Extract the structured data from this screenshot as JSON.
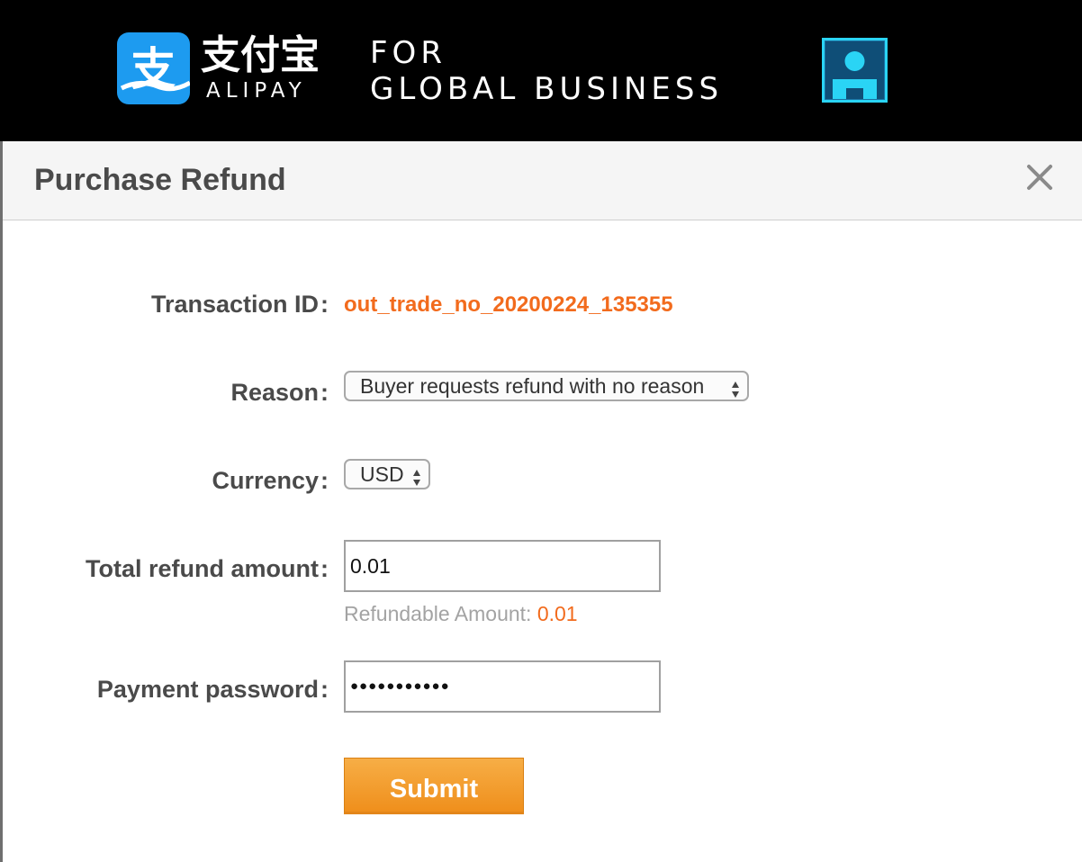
{
  "brand": {
    "chinese_name": "支付宝",
    "english_name": "ALIPAY",
    "tagline_line1": "FOR",
    "tagline_line2": "GLOBAL BUSINESS",
    "logo_glyph": "支",
    "colors": {
      "logo_blue": "#1d9bf0",
      "account_icon": "#2ad4f5"
    },
    "icons": [
      "alipay-logo-icon",
      "account-icon"
    ]
  },
  "dialog": {
    "title": "Purchase Refund",
    "close_icon": "close-icon"
  },
  "form": {
    "colon": ":",
    "transaction": {
      "label": "Transaction ID",
      "value": "out_trade_no_20200224_135355"
    },
    "reason": {
      "label": "Reason",
      "selected": "Buyer requests refund with no reason"
    },
    "currency": {
      "label": "Currency",
      "selected": "USD"
    },
    "total_refund": {
      "label": "Total refund amount",
      "value": "0.01"
    },
    "refundable": {
      "label": "Refundable Amount:",
      "value": "0.01"
    },
    "password": {
      "label": "Payment password",
      "masked_value": "●●●●●●●●●●●"
    },
    "submit_label": "Submit",
    "colors": {
      "accent_orange": "#f26b1d",
      "button_orange": "#f39a2c"
    }
  }
}
